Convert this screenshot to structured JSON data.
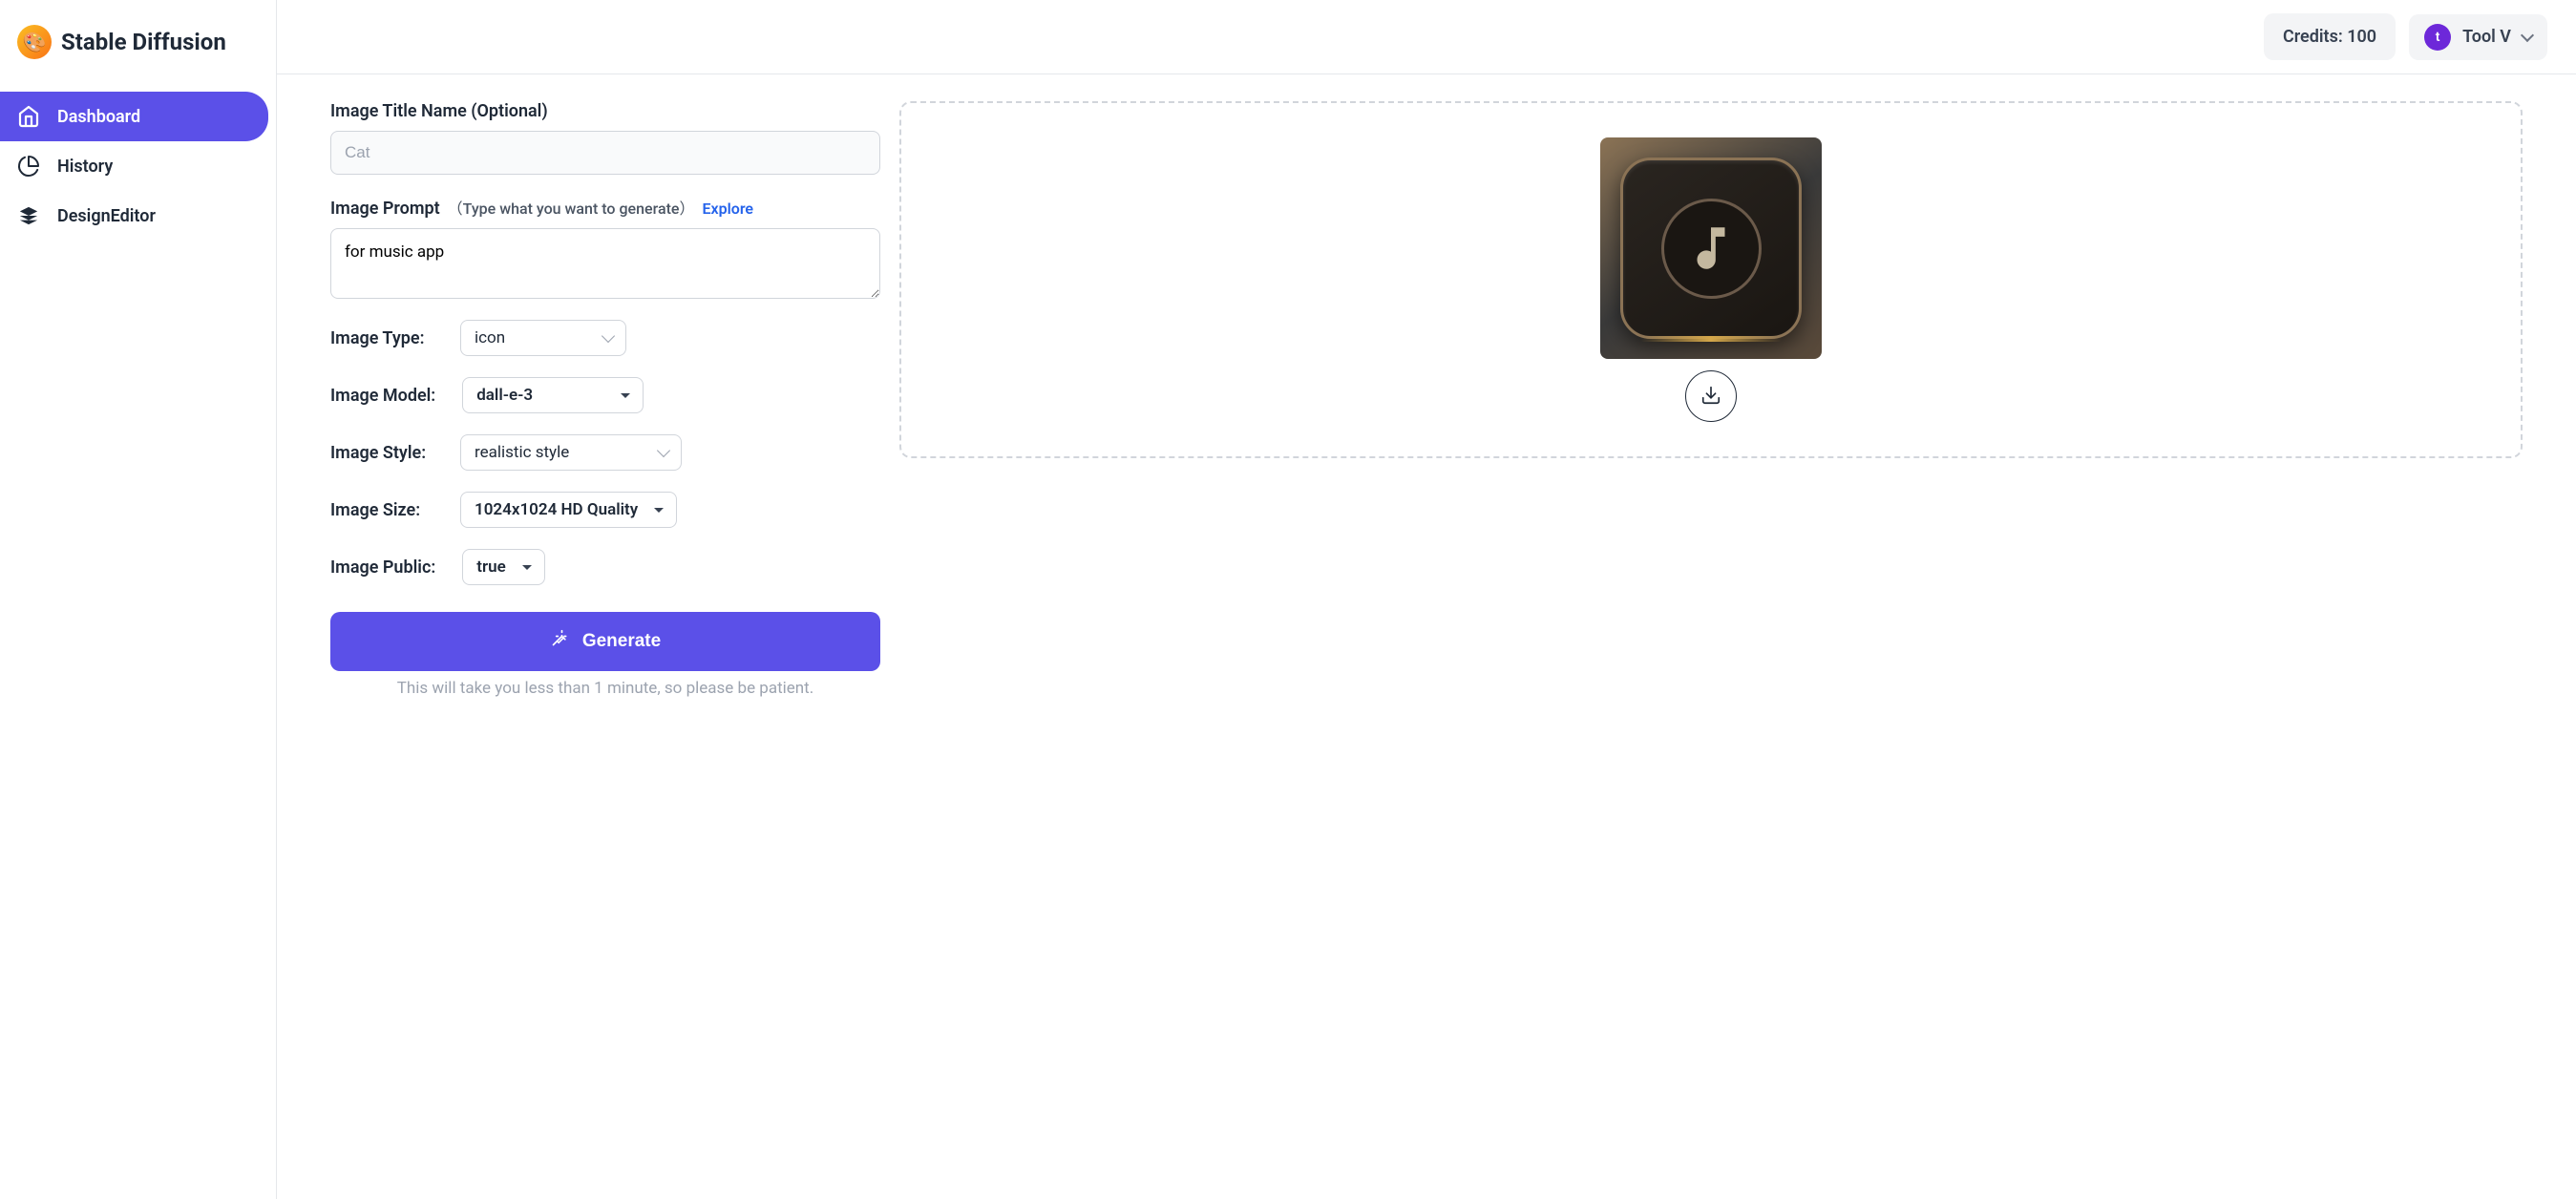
{
  "app": {
    "name": "Stable Diffusion"
  },
  "sidebar": {
    "items": [
      {
        "label": "Dashboard"
      },
      {
        "label": "History"
      },
      {
        "label": "DesignEditor"
      }
    ]
  },
  "header": {
    "credits_label": "Credits: 100",
    "user_initial": "t",
    "user_name": "Tool V"
  },
  "form": {
    "title_label": "Image Title Name (Optional)",
    "title_placeholder": "Cat",
    "title_value": "",
    "prompt_label": "Image Prompt",
    "prompt_hint": "（Type what you want to generate）",
    "explore_label": "Explore",
    "prompt_value": "for music app",
    "type_label": "Image Type:",
    "type_value": "icon",
    "model_label": "Image Model:",
    "model_value": "dall-e-3",
    "style_label": "Image Style:",
    "style_value": "realistic style",
    "size_label": "Image Size:",
    "size_value": "1024x1024 HD Quality",
    "public_label": "Image Public:",
    "public_value": "true",
    "generate_label": "Generate",
    "hint": "This will take you less than 1 minute, so please be patient."
  }
}
